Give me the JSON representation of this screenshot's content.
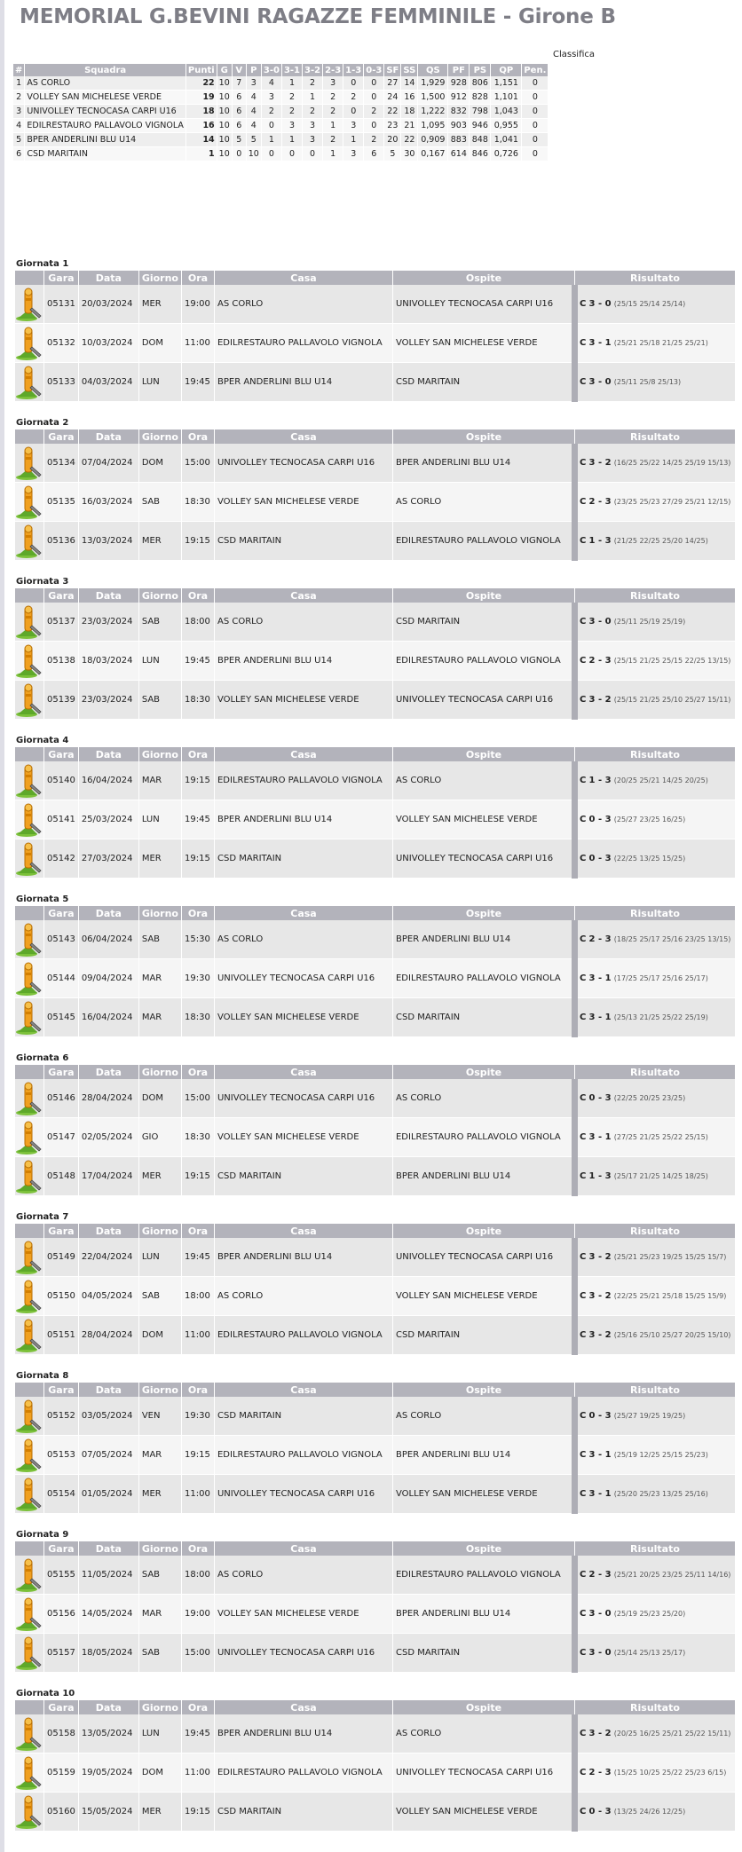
{
  "title": "MEMORIAL G.BEVINI RAGAZZE FEMMINILE - Girone B",
  "classifica_label": "Classifica",
  "standings": {
    "headers": [
      "#",
      "Squadra",
      "Punti",
      "G",
      "V",
      "P",
      "3-0",
      "3-1",
      "3-2",
      "2-3",
      "1-3",
      "0-3",
      "SF",
      "SS",
      "QS",
      "PF",
      "PS",
      "QP",
      "Pen."
    ],
    "rows": [
      [
        "1",
        "AS CORLO",
        "22",
        "10",
        "7",
        "3",
        "4",
        "1",
        "2",
        "3",
        "0",
        "0",
        "27",
        "14",
        "1,929",
        "928",
        "806",
        "1,151",
        "0"
      ],
      [
        "2",
        "VOLLEY SAN MICHELESE VERDE",
        "19",
        "10",
        "6",
        "4",
        "3",
        "2",
        "1",
        "2",
        "2",
        "0",
        "24",
        "16",
        "1,500",
        "912",
        "828",
        "1,101",
        "0"
      ],
      [
        "3",
        "UNIVOLLEY TECNOCASA CARPI U16",
        "18",
        "10",
        "6",
        "4",
        "2",
        "2",
        "2",
        "2",
        "0",
        "2",
        "22",
        "18",
        "1,222",
        "832",
        "798",
        "1,043",
        "0"
      ],
      [
        "4",
        "EDILRESTAURO PALLAVOLO VIGNOLA",
        "16",
        "10",
        "6",
        "4",
        "0",
        "3",
        "3",
        "1",
        "3",
        "0",
        "23",
        "21",
        "1,095",
        "903",
        "946",
        "0,955",
        "0"
      ],
      [
        "5",
        "BPER ANDERLINI BLU U14",
        "14",
        "10",
        "5",
        "5",
        "1",
        "1",
        "3",
        "2",
        "1",
        "2",
        "20",
        "22",
        "0,909",
        "883",
        "848",
        "1,041",
        "0"
      ],
      [
        "6",
        "CSD MARITAIN",
        "1",
        "10",
        "0",
        "10",
        "0",
        "0",
        "0",
        "1",
        "3",
        "6",
        "5",
        "30",
        "0,167",
        "614",
        "846",
        "0,726",
        "0"
      ]
    ]
  },
  "match_headers": [
    "",
    "Gara",
    "Data",
    "Giorno",
    "Ora",
    "Casa",
    "Ospite",
    "Risultato"
  ],
  "result_prefix": "C",
  "icon": "referee-whistle-icon",
  "giornate": [
    {
      "title": "Giornata 1",
      "matches": [
        {
          "gara": "05131",
          "data": "20/03/2024",
          "giorno": "MER",
          "ora": "19:00",
          "casa": "AS CORLO",
          "ospite": "UNIVOLLEY TECNOCASA CARPI U16",
          "score": "3 - 0",
          "sets": "(25/15 25/14 25/14)"
        },
        {
          "gara": "05132",
          "data": "10/03/2024",
          "giorno": "DOM",
          "ora": "11:00",
          "casa": "EDILRESTAURO PALLAVOLO VIGNOLA",
          "ospite": "VOLLEY SAN MICHELESE VERDE",
          "score": "3 - 1",
          "sets": "(25/21 25/18 21/25 25/21)"
        },
        {
          "gara": "05133",
          "data": "04/03/2024",
          "giorno": "LUN",
          "ora": "19:45",
          "casa": "BPER ANDERLINI BLU U14",
          "ospite": "CSD MARITAIN",
          "score": "3 - 0",
          "sets": "(25/11 25/8 25/13)"
        }
      ]
    },
    {
      "title": "Giornata 2",
      "matches": [
        {
          "gara": "05134",
          "data": "07/04/2024",
          "giorno": "DOM",
          "ora": "15:00",
          "casa": "UNIVOLLEY TECNOCASA CARPI U16",
          "ospite": "BPER ANDERLINI BLU U14",
          "score": "3 - 2",
          "sets": "(16/25 25/22 14/25 25/19 15/13)"
        },
        {
          "gara": "05135",
          "data": "16/03/2024",
          "giorno": "SAB",
          "ora": "18:30",
          "casa": "VOLLEY SAN MICHELESE VERDE",
          "ospite": "AS CORLO",
          "score": "2 - 3",
          "sets": "(23/25 25/23 27/29 25/21 12/15)"
        },
        {
          "gara": "05136",
          "data": "13/03/2024",
          "giorno": "MER",
          "ora": "19:15",
          "casa": "CSD MARITAIN",
          "ospite": "EDILRESTAURO PALLAVOLO VIGNOLA",
          "score": "1 - 3",
          "sets": "(21/25 22/25 25/20 14/25)"
        }
      ]
    },
    {
      "title": "Giornata 3",
      "matches": [
        {
          "gara": "05137",
          "data": "23/03/2024",
          "giorno": "SAB",
          "ora": "18:00",
          "casa": "AS CORLO",
          "ospite": "CSD MARITAIN",
          "score": "3 - 0",
          "sets": "(25/11 25/19 25/19)"
        },
        {
          "gara": "05138",
          "data": "18/03/2024",
          "giorno": "LUN",
          "ora": "19:45",
          "casa": "BPER ANDERLINI BLU U14",
          "ospite": "EDILRESTAURO PALLAVOLO VIGNOLA",
          "score": "2 - 3",
          "sets": "(25/15 21/25 25/15 22/25 13/15)"
        },
        {
          "gara": "05139",
          "data": "23/03/2024",
          "giorno": "SAB",
          "ora": "18:30",
          "casa": "VOLLEY SAN MICHELESE VERDE",
          "ospite": "UNIVOLLEY TECNOCASA CARPI U16",
          "score": "3 - 2",
          "sets": "(25/15 21/25 25/10 25/27 15/11)"
        }
      ]
    },
    {
      "title": "Giornata 4",
      "matches": [
        {
          "gara": "05140",
          "data": "16/04/2024",
          "giorno": "MAR",
          "ora": "19:15",
          "casa": "EDILRESTAURO PALLAVOLO VIGNOLA",
          "ospite": "AS CORLO",
          "score": "1 - 3",
          "sets": "(20/25 25/21 14/25 20/25)"
        },
        {
          "gara": "05141",
          "data": "25/03/2024",
          "giorno": "LUN",
          "ora": "19:45",
          "casa": "BPER ANDERLINI BLU U14",
          "ospite": "VOLLEY SAN MICHELESE VERDE",
          "score": "0 - 3",
          "sets": "(25/27 23/25 16/25)"
        },
        {
          "gara": "05142",
          "data": "27/03/2024",
          "giorno": "MER",
          "ora": "19:15",
          "casa": "CSD MARITAIN",
          "ospite": "UNIVOLLEY TECNOCASA CARPI U16",
          "score": "0 - 3",
          "sets": "(22/25 13/25 15/25)"
        }
      ]
    },
    {
      "title": "Giornata 5",
      "matches": [
        {
          "gara": "05143",
          "data": "06/04/2024",
          "giorno": "SAB",
          "ora": "15:30",
          "casa": "AS CORLO",
          "ospite": "BPER ANDERLINI BLU U14",
          "score": "2 - 3",
          "sets": "(18/25 25/17 25/16 23/25 13/15)"
        },
        {
          "gara": "05144",
          "data": "09/04/2024",
          "giorno": "MAR",
          "ora": "19:30",
          "casa": "UNIVOLLEY TECNOCASA CARPI U16",
          "ospite": "EDILRESTAURO PALLAVOLO VIGNOLA",
          "score": "3 - 1",
          "sets": "(17/25 25/17 25/16 25/17)"
        },
        {
          "gara": "05145",
          "data": "16/04/2024",
          "giorno": "MAR",
          "ora": "18:30",
          "casa": "VOLLEY SAN MICHELESE VERDE",
          "ospite": "CSD MARITAIN",
          "score": "3 - 1",
          "sets": "(25/13 21/25 25/22 25/19)"
        }
      ]
    },
    {
      "title": "Giornata 6",
      "matches": [
        {
          "gara": "05146",
          "data": "28/04/2024",
          "giorno": "DOM",
          "ora": "15:00",
          "casa": "UNIVOLLEY TECNOCASA CARPI U16",
          "ospite": "AS CORLO",
          "score": "0 - 3",
          "sets": "(22/25 20/25 23/25)"
        },
        {
          "gara": "05147",
          "data": "02/05/2024",
          "giorno": "GIO",
          "ora": "18:30",
          "casa": "VOLLEY SAN MICHELESE VERDE",
          "ospite": "EDILRESTAURO PALLAVOLO VIGNOLA",
          "score": "3 - 1",
          "sets": "(27/25 21/25 25/22 25/15)"
        },
        {
          "gara": "05148",
          "data": "17/04/2024",
          "giorno": "MER",
          "ora": "19:15",
          "casa": "CSD MARITAIN",
          "ospite": "BPER ANDERLINI BLU U14",
          "score": "1 - 3",
          "sets": "(25/17 21/25 14/25 18/25)"
        }
      ]
    },
    {
      "title": "Giornata 7",
      "matches": [
        {
          "gara": "05149",
          "data": "22/04/2024",
          "giorno": "LUN",
          "ora": "19:45",
          "casa": "BPER ANDERLINI BLU U14",
          "ospite": "UNIVOLLEY TECNOCASA CARPI U16",
          "score": "3 - 2",
          "sets": "(25/21 25/23 19/25 15/25 15/7)"
        },
        {
          "gara": "05150",
          "data": "04/05/2024",
          "giorno": "SAB",
          "ora": "18:00",
          "casa": "AS CORLO",
          "ospite": "VOLLEY SAN MICHELESE VERDE",
          "score": "3 - 2",
          "sets": "(22/25 25/21 25/18 15/25 15/9)"
        },
        {
          "gara": "05151",
          "data": "28/04/2024",
          "giorno": "DOM",
          "ora": "11:00",
          "casa": "EDILRESTAURO PALLAVOLO VIGNOLA",
          "ospite": "CSD MARITAIN",
          "score": "3 - 2",
          "sets": "(25/16 25/10 25/27 20/25 15/10)"
        }
      ]
    },
    {
      "title": "Giornata 8",
      "matches": [
        {
          "gara": "05152",
          "data": "03/05/2024",
          "giorno": "VEN",
          "ora": "19:30",
          "casa": "CSD MARITAIN",
          "ospite": "AS CORLO",
          "score": "0 - 3",
          "sets": "(25/27 19/25 19/25)"
        },
        {
          "gara": "05153",
          "data": "07/05/2024",
          "giorno": "MAR",
          "ora": "19:15",
          "casa": "EDILRESTAURO PALLAVOLO VIGNOLA",
          "ospite": "BPER ANDERLINI BLU U14",
          "score": "3 - 1",
          "sets": "(25/19 12/25 25/15 25/23)"
        },
        {
          "gara": "05154",
          "data": "01/05/2024",
          "giorno": "MER",
          "ora": "11:00",
          "casa": "UNIVOLLEY TECNOCASA CARPI U16",
          "ospite": "VOLLEY SAN MICHELESE VERDE",
          "score": "3 - 1",
          "sets": "(25/20 25/23 13/25 25/16)"
        }
      ]
    },
    {
      "title": "Giornata 9",
      "matches": [
        {
          "gara": "05155",
          "data": "11/05/2024",
          "giorno": "SAB",
          "ora": "18:00",
          "casa": "AS CORLO",
          "ospite": "EDILRESTAURO PALLAVOLO VIGNOLA",
          "score": "2 - 3",
          "sets": "(25/21 20/25 23/25 25/11 14/16)"
        },
        {
          "gara": "05156",
          "data": "14/05/2024",
          "giorno": "MAR",
          "ora": "19:00",
          "casa": "VOLLEY SAN MICHELESE VERDE",
          "ospite": "BPER ANDERLINI BLU U14",
          "score": "3 - 0",
          "sets": "(25/19 25/23 25/20)"
        },
        {
          "gara": "05157",
          "data": "18/05/2024",
          "giorno": "SAB",
          "ora": "15:00",
          "casa": "UNIVOLLEY TECNOCASA CARPI U16",
          "ospite": "CSD MARITAIN",
          "score": "3 - 0",
          "sets": "(25/14 25/13 25/17)"
        }
      ]
    },
    {
      "title": "Giornata 10",
      "matches": [
        {
          "gara": "05158",
          "data": "13/05/2024",
          "giorno": "LUN",
          "ora": "19:45",
          "casa": "BPER ANDERLINI BLU U14",
          "ospite": "AS CORLO",
          "score": "3 - 2",
          "sets": "(20/25 16/25 25/21 25/22 15/11)"
        },
        {
          "gara": "05159",
          "data": "19/05/2024",
          "giorno": "DOM",
          "ora": "11:00",
          "casa": "EDILRESTAURO PALLAVOLO VIGNOLA",
          "ospite": "UNIVOLLEY TECNOCASA CARPI U16",
          "score": "2 - 3",
          "sets": "(15/25 10/25 25/22 25/23 6/15)"
        },
        {
          "gara": "05160",
          "data": "15/05/2024",
          "giorno": "MER",
          "ora": "19:15",
          "casa": "CSD MARITAIN",
          "ospite": "VOLLEY SAN MICHELESE VERDE",
          "score": "0 - 3",
          "sets": "(13/25 24/26 12/25)"
        }
      ]
    }
  ]
}
